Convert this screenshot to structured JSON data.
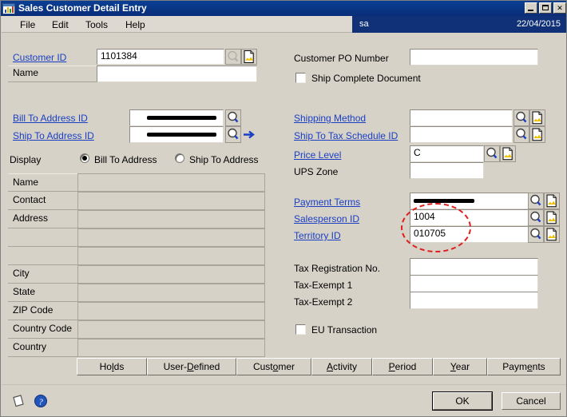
{
  "window": {
    "title": "Sales Customer Detail Entry",
    "icon": "window-chart-icon",
    "minimize_label": "_",
    "maximize_label": "□",
    "close_label": "✕"
  },
  "menu": {
    "items": [
      {
        "label": "File"
      },
      {
        "label": "Edit"
      },
      {
        "label": "Tools"
      },
      {
        "label": "Help"
      }
    ]
  },
  "userstrip": {
    "user": "sa",
    "date": "22/04/2015"
  },
  "left_panel": {
    "customer_id": {
      "label": "Customer ID",
      "value": "1101384",
      "lookup_icon": "magnifier-icon-disabled",
      "note_icon": "note-icon"
    },
    "name": {
      "label": "Name",
      "value": ""
    },
    "bill_to_address_id": {
      "label": "Bill To Address ID",
      "value": "",
      "redacted": true,
      "lookup_icon": "magnifier-icon"
    },
    "ship_to_address_id": {
      "label": "Ship To Address ID",
      "value": "",
      "redacted": true,
      "lookup_icon": "magnifier-icon",
      "goto_icon": "arrow-right-icon"
    },
    "display": {
      "label": "Display",
      "options": [
        {
          "label": "Bill To Address",
          "selected": true
        },
        {
          "label": "Ship To Address",
          "selected": false
        }
      ]
    },
    "address_fields": [
      {
        "label": "Name",
        "value": ""
      },
      {
        "label": "Contact",
        "value": ""
      },
      {
        "label": "Address",
        "value": ""
      },
      {
        "label": "",
        "value": ""
      },
      {
        "label": "",
        "value": ""
      },
      {
        "label": "City",
        "value": ""
      },
      {
        "label": "State",
        "value": ""
      },
      {
        "label": "ZIP Code",
        "value": ""
      },
      {
        "label": "Country Code",
        "value": ""
      },
      {
        "label": "Country",
        "value": ""
      }
    ]
  },
  "right_panel": {
    "customer_po_number": {
      "label": "Customer PO Number",
      "value": ""
    },
    "ship_complete_document": {
      "label": "Ship Complete Document",
      "checked": false
    },
    "shipping_method": {
      "label": "Shipping Method",
      "value": "",
      "lookup_icon": "magnifier-icon",
      "note_icon": "note-icon"
    },
    "ship_to_tax_schedule_id": {
      "label": "Ship To Tax Schedule ID",
      "value": "",
      "lookup_icon": "magnifier-icon",
      "note_icon": "note-icon"
    },
    "price_level": {
      "label": "Price Level",
      "value": "C",
      "lookup_icon": "magnifier-icon",
      "note_icon": "note-icon"
    },
    "ups_zone": {
      "label": "UPS Zone",
      "value": ""
    },
    "payment_terms": {
      "label": "Payment Terms",
      "value": "",
      "redacted": true,
      "lookup_icon": "magnifier-icon",
      "note_icon": "note-icon"
    },
    "salesperson_id": {
      "label": "Salesperson ID",
      "value": "1004",
      "lookup_icon": "magnifier-icon",
      "note_icon": "note-icon"
    },
    "territory_id": {
      "label": "Territory ID",
      "value": "010705",
      "lookup_icon": "magnifier-icon",
      "note_icon": "note-icon"
    },
    "tax_registration_no": {
      "label": "Tax Registration No.",
      "value": ""
    },
    "tax_exempt_1": {
      "label": "Tax-Exempt 1",
      "value": ""
    },
    "tax_exempt_2": {
      "label": "Tax-Exempt 2",
      "value": ""
    },
    "eu_transaction": {
      "label": "EU Transaction",
      "checked": false
    }
  },
  "annotation": {
    "shape": "ellipse",
    "color": "#e21b1b",
    "style": "dash-dot",
    "targets": [
      "Salesperson ID",
      "Territory ID"
    ]
  },
  "toolbuttons": [
    {
      "label": "Holds",
      "pre": "Ho",
      "accel": "l",
      "post": "ds"
    },
    {
      "label": "User-Defined",
      "pre": "User-",
      "accel": "D",
      "post": "efined"
    },
    {
      "label": "Customer",
      "pre": "Cust",
      "accel": "o",
      "post": "mer"
    },
    {
      "label": "Activity",
      "pre": "",
      "accel": "A",
      "post": "ctivity"
    },
    {
      "label": "Period",
      "pre": "",
      "accel": "P",
      "post": "eriod"
    },
    {
      "label": "Year",
      "pre": "",
      "accel": "Y",
      "post": "ear"
    },
    {
      "label": "Payments",
      "pre": "Paym",
      "accel": "e",
      "post": "nts"
    }
  ],
  "statusbar": {
    "note_icon": "note-page-icon",
    "help_icon": "help-question-icon",
    "ok_label": "OK",
    "cancel_label": "Cancel"
  },
  "colors": {
    "face": "#d6d2c8",
    "titlebar": "#0a2d78",
    "link": "#1a3fc4",
    "annotation": "#e21b1b",
    "field_bg": "#ffffff"
  }
}
